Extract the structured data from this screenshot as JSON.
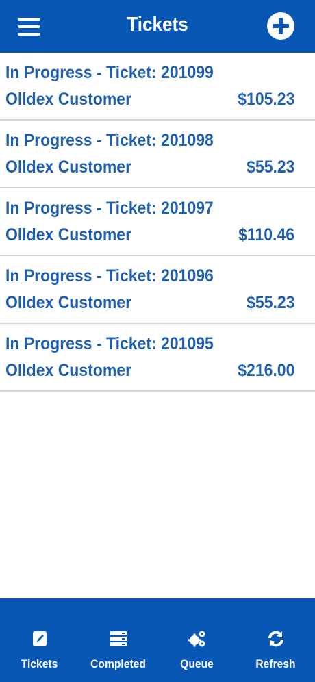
{
  "header": {
    "title": "Tickets",
    "menu_icon": "hamburger-menu-icon",
    "add_icon": "plus-circle-icon"
  },
  "tickets": [
    {
      "title": "In Progress - Ticket: 201099",
      "customer": "Olldex Customer",
      "amount": "$105.23"
    },
    {
      "title": "In Progress - Ticket: 201098",
      "customer": "Olldex Customer",
      "amount": "$55.23"
    },
    {
      "title": "In Progress - Ticket: 201097",
      "customer": "Olldex Customer",
      "amount": "$110.46"
    },
    {
      "title": "In Progress - Ticket: 201096",
      "customer": "Olldex Customer",
      "amount": "$55.23"
    },
    {
      "title": "In Progress - Ticket: 201095",
      "customer": "Olldex Customer",
      "amount": "$216.00"
    }
  ],
  "tabbar": {
    "items": [
      {
        "label": "Tickets",
        "icon": "edit-icon"
      },
      {
        "label": "Completed",
        "icon": "server-stack-icon"
      },
      {
        "label": "Queue",
        "icon": "gears-icon"
      },
      {
        "label": "Refresh",
        "icon": "refresh-icon"
      }
    ]
  },
  "colors": {
    "primary": "#0857b5",
    "text_blue": "#1f5fad",
    "divider": "#d6d6d6",
    "background": "#ffffff"
  }
}
